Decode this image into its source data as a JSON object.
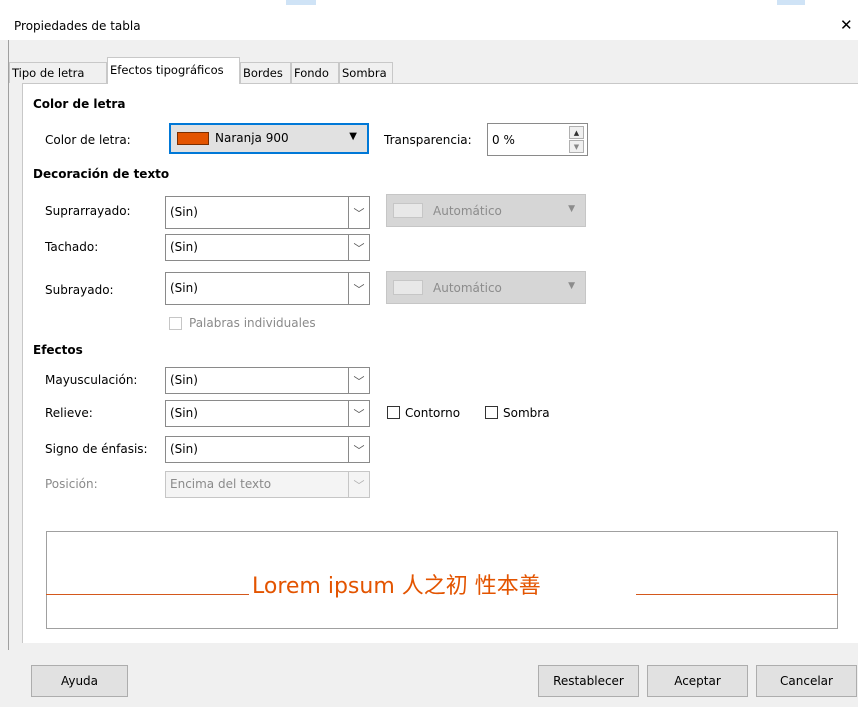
{
  "window": {
    "title": "Propiedades de tabla",
    "close_glyph": "✕"
  },
  "tabs": [
    {
      "label": "Tipo de letra",
      "active": false
    },
    {
      "label": "Efectos tipográficos",
      "active": true
    },
    {
      "label": "Bordes",
      "active": false
    },
    {
      "label": "Fondo",
      "active": false
    },
    {
      "label": "Sombra",
      "active": false
    }
  ],
  "font_color": {
    "section_title": "Color de letra",
    "label": "Color de letra:",
    "value": "Naranja 900",
    "swatch_color": "#e35400",
    "transparency_label": "Transparencia:",
    "transparency_value": "0 %"
  },
  "text_decoration": {
    "section_title": "Decoración de texto",
    "overline_label": "Suprarrayado:",
    "overline_value": "(Sin)",
    "overline_color": "Automático",
    "strikethrough_label": "Tachado:",
    "strikethrough_value": "(Sin)",
    "underline_label": "Subrayado:",
    "underline_value": "(Sin)",
    "underline_color": "Automático",
    "individual_words_label": "Palabras individuales"
  },
  "effects": {
    "section_title": "Efectos",
    "case_label": "Mayusculación:",
    "case_value": "(Sin)",
    "relief_label": "Relieve:",
    "relief_value": "(Sin)",
    "outline_label": "Contorno",
    "shadow_label": "Sombra",
    "emphasis_label": "Signo de énfasis:",
    "emphasis_value": "(Sin)",
    "position_label": "Posición:",
    "position_value": "Encima del texto"
  },
  "preview": {
    "text": "Lorem ipsum   人之初 性本善",
    "color": "#e35400"
  },
  "buttons": {
    "help": "Ayuda",
    "reset": "Restablecer",
    "ok": "Aceptar",
    "cancel": "Cancelar"
  }
}
